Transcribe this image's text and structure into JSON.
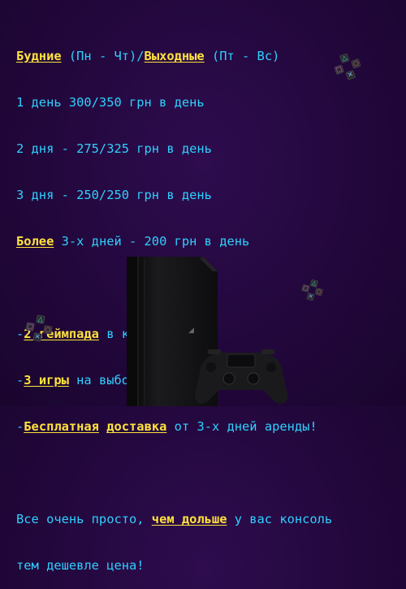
{
  "promo": {
    "line1": {
      "weekdays": "Будние",
      "weekdays_range": " (Пн - Чт)/",
      "weekend": "Выходные",
      "weekend_range": " (Пт - Вс)"
    },
    "line2": "1 день 300/350 грн в день",
    "line3": "2 дня - 275/325 грн в день",
    "line4": "3 дня - 250/250 грн в день",
    "line5": {
      "more": "Более",
      "rest": " 3-х дней - 200 грн в день"
    },
    "feature1": {
      "dash": "-",
      "highlight": "2 геймпада",
      "rest": " в комплекте!"
    },
    "feature2": {
      "dash": "-",
      "highlight": "3 игры",
      "rest": " на выбор!"
    },
    "feature3": {
      "dash": "-",
      "highlight1": "Бесплатная",
      "space": " ",
      "highlight2": "доставка",
      "rest": " от 3-х дней аренды!"
    },
    "closing1": {
      "pre": "Все очень просто, ",
      "highlight": "чем дольше",
      "post": " у вас консоль"
    },
    "closing2": "тем дешевле цена!"
  },
  "colors": {
    "accent_text": "#2fd0ff",
    "highlight": "#ffe23d",
    "background": "#22073c"
  },
  "icons": [
    "playstation-button-cluster-icon",
    "ps4-console-icon",
    "dualshock-gamepad-icon"
  ]
}
